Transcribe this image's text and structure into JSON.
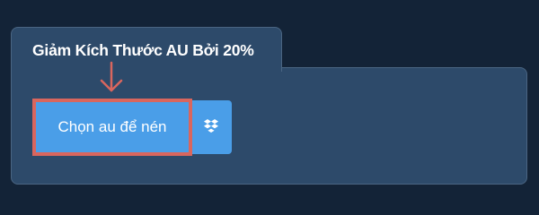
{
  "header": {
    "tab_title": "Giảm Kích Thước AU Bởi 20%"
  },
  "upload": {
    "choose_label": "Chọn au để nén",
    "dropbox_icon": "dropbox-icon"
  },
  "colors": {
    "page_background": "#132337",
    "panel_background": "#2d4a6a",
    "button_blue": "#4a9ee8",
    "highlight_red": "#d9665e"
  }
}
